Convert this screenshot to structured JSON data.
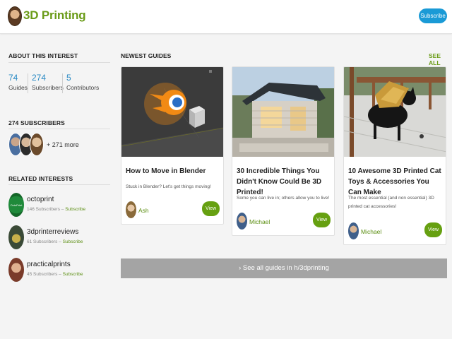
{
  "header": {
    "title": "3D Printing",
    "subscribe_label": "Subscribe"
  },
  "sidebar": {
    "about_heading": "About This Interest",
    "stats": [
      {
        "value": "74",
        "label": "Guides"
      },
      {
        "value": "274",
        "label": "Subscribers"
      },
      {
        "value": "5",
        "label": "Contributors"
      }
    ],
    "subscribers_heading": "274 Subscribers",
    "more_text": "+ 271 more",
    "related_heading": "Related Interests",
    "related": [
      {
        "name": "octoprint",
        "meta": "146 Subscribers – ",
        "subscribe": "Subscribe",
        "icon": "octoprint-icon"
      },
      {
        "name": "3dprinterreviews",
        "meta": "61 Subscribers – ",
        "subscribe": "Subscribe",
        "icon": "printer-icon"
      },
      {
        "name": "practicalprints",
        "meta": "45 Subscribers – ",
        "subscribe": "Subscribe",
        "icon": "user-avatar-icon"
      }
    ]
  },
  "main": {
    "heading": "Newest Guides",
    "see_all": "See All",
    "cards": [
      {
        "title": "How to Move in Blender",
        "description": "Stuck in Blender? Let's get things moving!",
        "author": "Ash",
        "view": "View",
        "image": "blender-scene"
      },
      {
        "title": "30 Incredible Things You Didn't Know Could Be 3D Printed!",
        "description": "Some you can live in; others allow you to live!",
        "author": "Michael",
        "view": "View",
        "image": "printed-house"
      },
      {
        "title": "10 Awesome 3D Printed Cat Toys & Accessories You Can Make",
        "description": "The most essential (and non essential) 3D printed cat accessories!",
        "author": "Michael",
        "view": "View",
        "image": "cat-on-deck"
      }
    ],
    "see_all_bar": "› See all guides in h/3dprinting"
  },
  "colors": {
    "accent_green": "#6a9b17",
    "link_blue": "#2a8ac4",
    "subscribe_blue": "#1a9ad6",
    "view_green": "#66a011",
    "bar_gray": "#a4a4a4"
  }
}
